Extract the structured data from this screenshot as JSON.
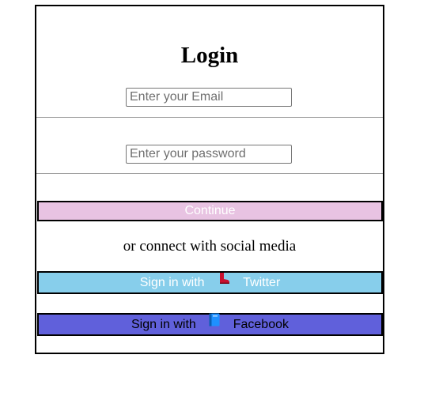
{
  "form": {
    "title": "Login",
    "email_placeholder": "Enter your Email",
    "password_placeholder": "Enter your password",
    "continue_label": "Continue",
    "social_text": "or connect with social media"
  },
  "social": {
    "twitter": {
      "prefix": "Sign in with",
      "label": "Twitter",
      "icon": "boot-icon",
      "color": "#87ceeb"
    },
    "facebook": {
      "prefix": "Sign in with",
      "label": "Facebook",
      "icon": "book-icon",
      "color": "#6060db"
    }
  },
  "colors": {
    "continue_bg": "#e8c3e2",
    "border": "#000000"
  }
}
